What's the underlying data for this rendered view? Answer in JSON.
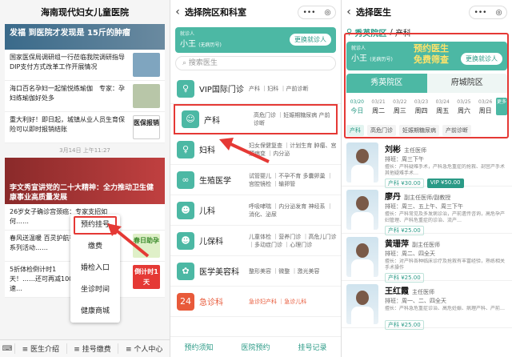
{
  "p1": {
    "title": "海南现代妇女儿童医院",
    "hero1": "发福 到医院才发现是 15斤的肿瘤",
    "news": [
      {
        "text": "国家医保局调研组一行莅临我院调研指导DIP支付方式改革工作开展情况"
      },
      {
        "text": "海口百名孕妇一起愉悦练瑜伽　专家：孕妇练瑜伽好处多"
      },
      {
        "text": "重大利好！即日起，城镇从业人员生育保险可以即时报销结账",
        "badge": "医保报销"
      }
    ],
    "timestamp": "3月14日 上午11:27",
    "hero2": "李文秀宣讲党的二十大精神：全力推动卫生健康事业高质量发展",
    "news2": [
      {
        "text": "26岁女子确诊宫颈癌：专家支招如何……"
      },
      {
        "text": "春风送温暖 百灵护航行系列活动……",
        "badge": "春日助孕"
      },
      {
        "text": "5折体检倒计时1天！……还可再减100，速…",
        "badge": "倒计时1天"
      }
    ],
    "popup": [
      "预约挂号",
      "缴费",
      "婚检入口",
      "坐诊时间",
      "健康商城"
    ],
    "bottom_tabs": [
      "医生介绍",
      "挂号缴费",
      "个人中心"
    ]
  },
  "p2": {
    "title": "选择院区和科室",
    "user_label": "就诊人",
    "user_name": "小王",
    "user_note": "(无病历号)",
    "switch": "更换就诊人",
    "search_placeholder": "搜索医生",
    "depts": [
      {
        "name": "VIP国际门诊",
        "desc": "产科 ｜妇科 ｜产前诊断",
        "icon": "♀"
      },
      {
        "name": "产科",
        "desc": "高危门诊 ｜妊娠期糖尿病 产前诊断",
        "icon": "☺"
      },
      {
        "name": "妇科",
        "desc": "妇女保健复查 ｜计划生育 肿瘤、宫颈病变 ｜内分泌",
        "icon": "♀"
      },
      {
        "name": "生殖医学",
        "desc": "试管婴儿 ｜不孕不育 多囊卵巢 ｜宫腔镜检 ｜输卵管",
        "icon": "∞"
      },
      {
        "name": "儿科",
        "desc": "呼吸哮喘 ｜内分泌发育 神经系 ｜消化、泌尿",
        "icon": "☻"
      },
      {
        "name": "儿保科",
        "desc": "儿童体检 ｜营养门诊 ｜高危儿门诊 ｜多动症门诊 ｜心理门诊",
        "icon": "☻"
      },
      {
        "name": "医学美容科",
        "desc": "整形美容 ｜微整 ｜激光美容",
        "icon": "✿"
      },
      {
        "name": "急诊科",
        "desc": "急诊妇产科 ｜急诊儿科",
        "icon": "24"
      }
    ],
    "bottom": [
      "预约须知",
      "医院预约",
      "挂号记录"
    ]
  },
  "p3": {
    "title": "选择医生",
    "campus": "秀英院区",
    "dept": "产科",
    "user_label": "就诊人",
    "user_name": "小王",
    "user_note": "(无病历号)",
    "promo1": "预约医生",
    "promo2": "免费筛查",
    "switch": "更换就诊人",
    "campuses": [
      "秀英院区",
      "府城院区"
    ],
    "dates": [
      {
        "d": "03/20",
        "w": "今日"
      },
      {
        "d": "03/21",
        "w": "周二"
      },
      {
        "d": "03/22",
        "w": "周三"
      },
      {
        "d": "03/23",
        "w": "周四"
      },
      {
        "d": "03/24",
        "w": "周五"
      },
      {
        "d": "03/25",
        "w": "周六"
      },
      {
        "d": "03/26",
        "w": "周日"
      }
    ],
    "more": "更多",
    "filters": [
      "产科",
      "高危门诊",
      "妊娠期糖尿病",
      "产前诊断"
    ],
    "doctors": [
      {
        "name": "刘彬",
        "title": "主任医师",
        "sched": "排班：周三下午",
        "spec": "擅长：产科疑难手术，产科急危重症的抢救、剖宫产手术 其他疑难手术…",
        "p1": "产科 ¥30.00",
        "p2": "VIP ¥50.00"
      },
      {
        "name": "廖丹",
        "title": "副主任医师/副教授",
        "sched": "排班：周三、五上午、周三下午",
        "spec": "擅长：产科常见及多发病诊治，产前遗传咨询，高危孕产妇管理、产科危重症的诊治、流产…",
        "p1": "产科 ¥25.00"
      },
      {
        "name": "黄珊萍",
        "title": "副主任医师",
        "sched": "排班：周二、四全天",
        "spec": "擅长：对产科各种临床诊疗及抢救有丰富经验，熟练相关手术操作",
        "p1": "产科 ¥25.00"
      },
      {
        "name": "王红霞",
        "title": "主任医师",
        "sched": "排班：周一、二、四全天",
        "spec": "擅长：产科急危重症诊治、高危妊娠、病理产科、产前…",
        "p1": "产科 ¥25.00"
      }
    ]
  }
}
